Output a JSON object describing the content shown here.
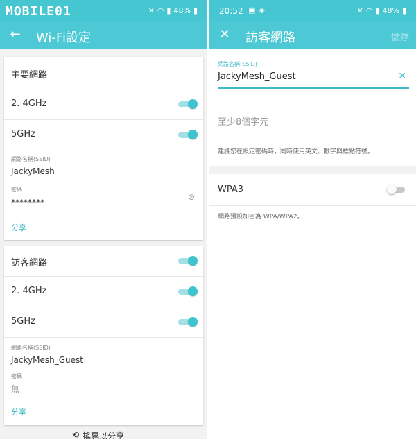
{
  "left": {
    "status": {
      "logo": "MOBILE01",
      "mute": "🔇",
      "wifi": "📶",
      "signal": "📶",
      "battery": "48%"
    },
    "appbar": {
      "title": "Wi-Fi設定"
    },
    "main": {
      "header": "主要網路",
      "band_24": "2. 4GHz",
      "band_5": "5GHz",
      "ssid_label": "網路名稱(SSID)",
      "ssid_value": "JackyMesh",
      "pw_label": "密碼",
      "pw_value": "********",
      "share": "分享"
    },
    "guest": {
      "header": "訪客網路",
      "band_24": "2. 4GHz",
      "band_5": "5GHz",
      "ssid_label": "網路名稱(SSID)",
      "ssid_value": "JackyMesh_Guest",
      "pw_label": "密碼",
      "pw_value": "無",
      "share": "分享"
    },
    "footer_text": "搖晃以分享"
  },
  "right": {
    "status": {
      "time": "20:52",
      "battery": "48%"
    },
    "appbar": {
      "title": "訪客網路",
      "save": "儲存"
    },
    "ssid_label": "網路名稱(SSID)",
    "ssid_value": "JackyMesh_Guest",
    "password_placeholder": "至少8個字元",
    "hint": "建議您在設定密碼時，同時使用英文、數字與標點符號。",
    "wpa3_label": "WPA3",
    "wpa3_note": "網路預設加密為 WPA/WPA2。"
  },
  "colors": {
    "accent": "#4dc9d5",
    "accent_dark": "#3fc3cf"
  }
}
